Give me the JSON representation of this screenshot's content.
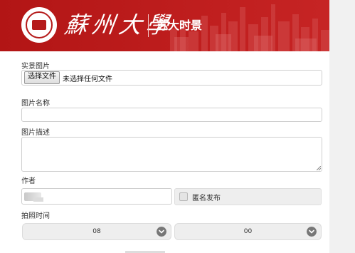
{
  "header": {
    "brand_calligraphy": "蘇州大學",
    "site_title": "苏大时景",
    "colors": {
      "header_bg": "#b51a1a",
      "text": "#ffffff"
    }
  },
  "form": {
    "photo": {
      "label": "实景图片",
      "file_button_label": "选择文件",
      "file_status": "未选择任何文件"
    },
    "name": {
      "label": "图片名称",
      "value": "",
      "placeholder": ""
    },
    "description": {
      "label": "图片描述",
      "value": ""
    },
    "author": {
      "label": "作者",
      "value": ""
    },
    "anonymous": {
      "label": "匿名发布",
      "checked": false
    },
    "shot_time": {
      "label": "拍照时间",
      "month": {
        "value": "08",
        "icon": "chevron-down-icon"
      },
      "day": {
        "value": "00",
        "icon": "chevron-down-icon"
      }
    }
  }
}
